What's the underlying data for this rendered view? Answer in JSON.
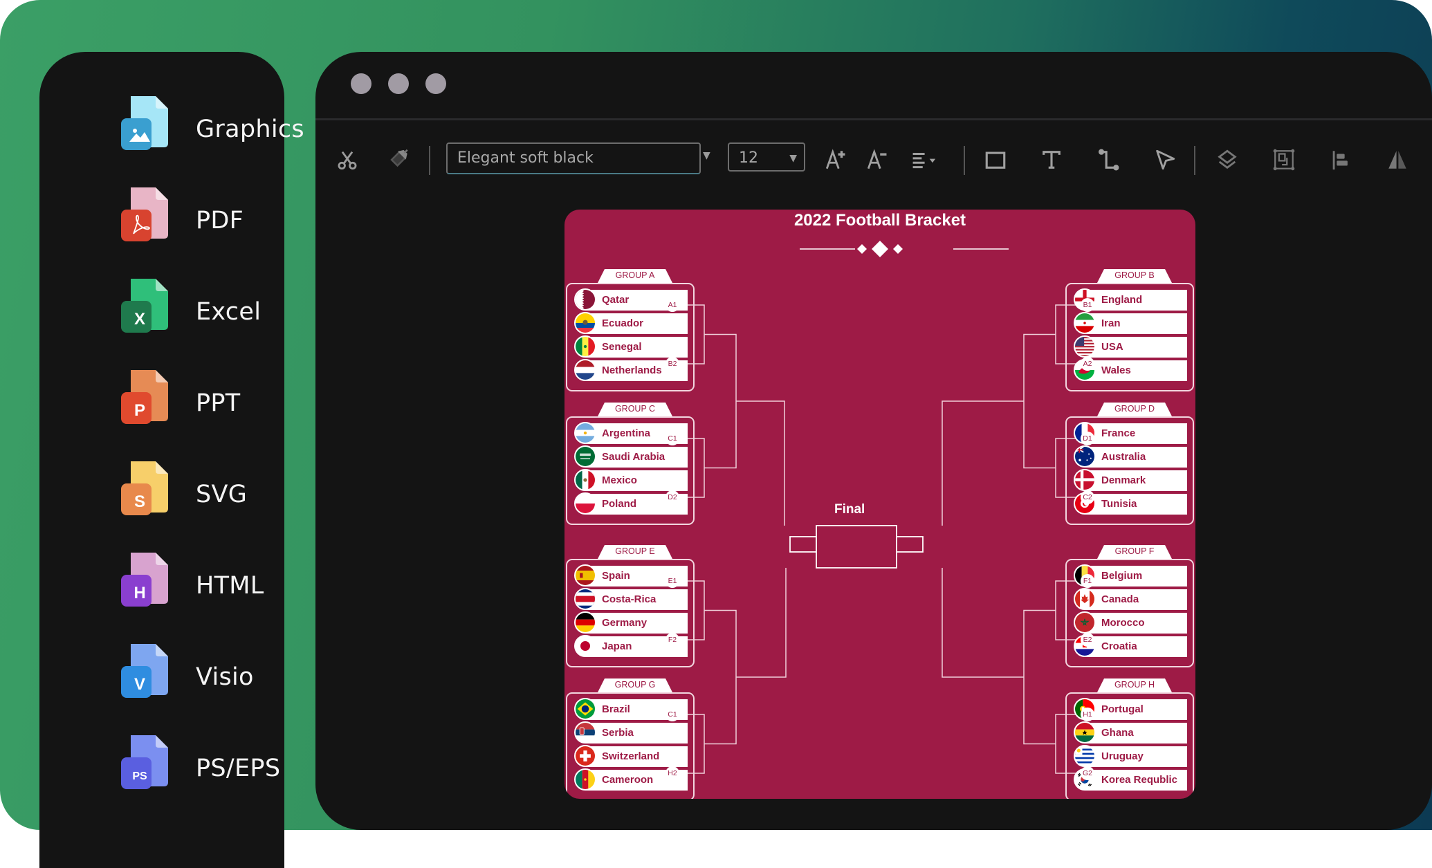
{
  "sidebar": {
    "items": [
      {
        "label": "Graphics",
        "icon": "graphics-file-icon",
        "color": "#3a9fd0"
      },
      {
        "label": "PDF",
        "icon": "pdf-file-icon",
        "color": "#d8432f"
      },
      {
        "label": "Excel",
        "icon": "excel-file-icon",
        "color": "#1f7a4d"
      },
      {
        "label": "PPT",
        "icon": "ppt-file-icon",
        "color": "#e04a2e"
      },
      {
        "label": "SVG",
        "icon": "svg-file-icon",
        "color": "#e8894c"
      },
      {
        "label": "HTML",
        "icon": "html-file-icon",
        "color": "#8a3fcf"
      },
      {
        "label": "Visio",
        "icon": "visio-file-icon",
        "color": "#2f8de0"
      },
      {
        "label": "PS/EPS",
        "icon": "ps-eps-file-icon",
        "color": "#5a5fe0"
      }
    ],
    "badges": [
      "",
      "",
      "X",
      "P",
      "S",
      "H",
      "V",
      "PS"
    ]
  },
  "toolbar": {
    "font_family": "Elegant soft black",
    "font_size": "12",
    "tools": [
      "cut",
      "format-painter",
      "font-family",
      "font-size",
      "increase-font",
      "decrease-font",
      "align",
      "rectangle",
      "text",
      "connector",
      "select",
      "layers",
      "group",
      "align-left",
      "flip"
    ]
  },
  "bracket": {
    "title": "2022 Football Bracket",
    "final_label": "Final",
    "background": "#9e1b46",
    "groups": [
      {
        "name": "GROUP A",
        "side": "left",
        "teams": [
          "Qatar",
          "Ecuador",
          "Senegal",
          "Netherlands"
        ],
        "seeds": [
          "A1",
          "B2"
        ]
      },
      {
        "name": "GROUP C",
        "side": "left",
        "teams": [
          "Argentina",
          "Saudi Arabia",
          "Mexico",
          "Poland"
        ],
        "seeds": [
          "C1",
          "D2"
        ]
      },
      {
        "name": "GROUP E",
        "side": "left",
        "teams": [
          "Spain",
          "Costa-Rica",
          "Germany",
          "Japan"
        ],
        "seeds": [
          "E1",
          "F2"
        ]
      },
      {
        "name": "GROUP G",
        "side": "left",
        "teams": [
          "Brazil",
          "Serbia",
          "Switzerland",
          "Cameroon"
        ],
        "seeds": [
          "C1",
          "H2"
        ]
      },
      {
        "name": "GROUP B",
        "side": "right",
        "teams": [
          "England",
          "Iran",
          "USA",
          "Wales"
        ],
        "seeds": [
          "B1",
          "A2"
        ]
      },
      {
        "name": "GROUP D",
        "side": "right",
        "teams": [
          "France",
          "Australia",
          "Denmark",
          "Tunisia"
        ],
        "seeds": [
          "D1",
          "C2"
        ]
      },
      {
        "name": "GROUP F",
        "side": "right",
        "teams": [
          "Belgium",
          "Canada",
          "Morocco",
          "Croatia"
        ],
        "seeds": [
          "F1",
          "E2"
        ]
      },
      {
        "name": "GROUP H",
        "side": "right",
        "teams": [
          "Portugal",
          "Ghana",
          "Uruguay",
          "Korea Requblic"
        ],
        "seeds": [
          "H1",
          "G2"
        ]
      }
    ]
  }
}
